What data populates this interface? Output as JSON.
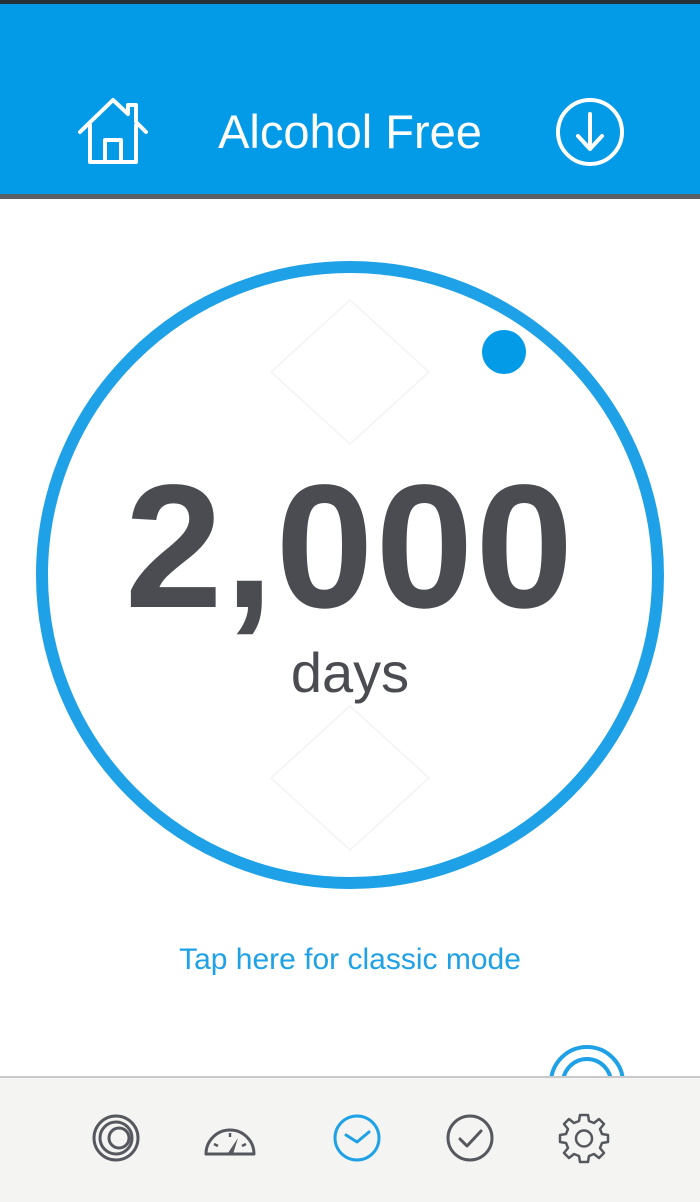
{
  "header": {
    "title": "Alcohol Free",
    "home_icon": "home-icon",
    "download_icon": "download-circle-icon"
  },
  "counter": {
    "value": "2,000",
    "unit": "days",
    "dial_progress_marker": "knob-dot"
  },
  "classic_mode_link": "Tap here for classic mode",
  "bottom_nav": {
    "items": [
      {
        "icon": "rings-icon",
        "active": false
      },
      {
        "icon": "speedometer-icon",
        "active": false
      },
      {
        "icon": "clock-icon",
        "active": true
      },
      {
        "icon": "checkmark-circle-icon",
        "active": false
      },
      {
        "icon": "gear-icon",
        "active": false
      }
    ]
  },
  "colors": {
    "accent": "#039ae8",
    "ring": "#1ea1e6",
    "text_dark": "#4a4c52",
    "nav_inactive": "#55585e",
    "nav_bg": "#f4f4f2"
  }
}
